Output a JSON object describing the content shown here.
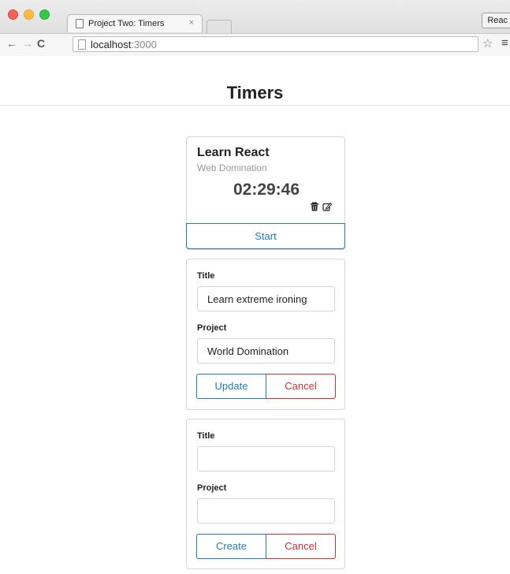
{
  "browser": {
    "tab_title": "Project Two: Timers",
    "tab_close": "×",
    "extension_label": "Reac",
    "url_host": "localhost",
    "url_port": ":3000",
    "colors": {
      "close": "#fc605b",
      "minimize": "#fdbc40",
      "zoom": "#34c84a"
    }
  },
  "page": {
    "title": "Timers"
  },
  "timer": {
    "title": "Learn React",
    "project": "Web Domination",
    "elapsed": "02:29:46",
    "start_label": "Start"
  },
  "edit_form": {
    "title_label": "Title",
    "title_value": "Learn extreme ironing",
    "project_label": "Project",
    "project_value": "World Domination",
    "submit_label": "Update",
    "cancel_label": "Cancel"
  },
  "create_form": {
    "title_label": "Title",
    "title_value": "",
    "project_label": "Project",
    "project_value": "",
    "submit_label": "Create",
    "cancel_label": "Cancel"
  },
  "colors": {
    "primary": "#2a7ab0",
    "danger": "#cc3333"
  }
}
